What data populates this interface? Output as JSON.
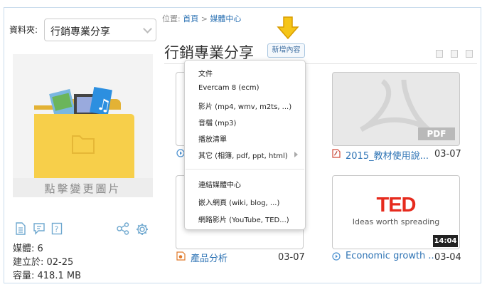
{
  "folder": {
    "label": "資料夾:",
    "selected": "行銷專業分享"
  },
  "cover": {
    "caption": "點擊變更圖片"
  },
  "stats": {
    "media": "媒體: 6",
    "created": "建立於: 02-25",
    "capacity": "容量: 418.1 MB"
  },
  "breadcrumb": {
    "prefix": "位置:",
    "home": "首頁",
    "sep": ">",
    "current": "媒體中心"
  },
  "header": {
    "title": "行銷專業分享",
    "add_button": "新增內容"
  },
  "menu": {
    "items": [
      "文件",
      "Evercam 8 (ecm)",
      "影片 (mp4, wmv, m2ts, ...)",
      "音檔 (mp3)",
      "播放清單",
      "其它 (相簿, pdf, ppt, html)"
    ],
    "links": [
      "連結媒體中心",
      "嵌入網頁 (wiki, blog, ...)",
      "網路影片 (YouTube, TED...)"
    ]
  },
  "cards": [
    {
      "name": "2015_教材使用說...",
      "date": "03-07",
      "badge": "PDF"
    },
    {
      "name": "產品分析",
      "date": "03-07"
    },
    {
      "name": "Economic growth ...",
      "date": "03-04",
      "logo": "TED",
      "tagline": "Ideas worth spreading",
      "duration": "14:04"
    }
  ],
  "colors": {
    "accent": "#2f74b5",
    "arrow": "#f5c518",
    "ted_red": "#e62b1e",
    "folder": "#f7cf4a"
  }
}
